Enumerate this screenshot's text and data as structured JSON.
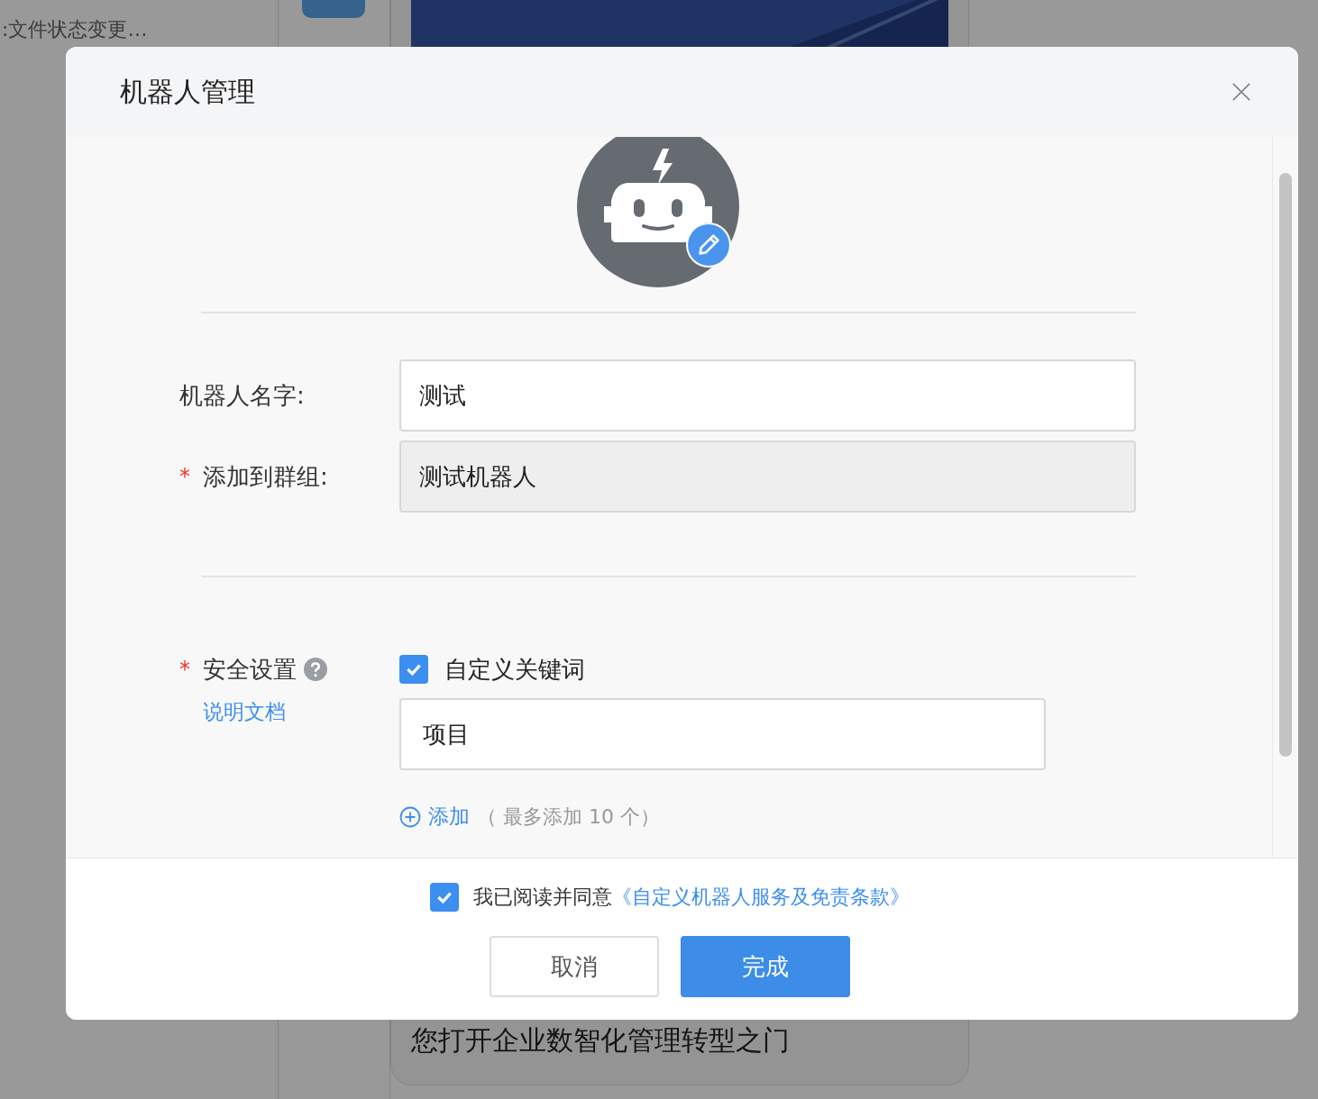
{
  "background": {
    "list_item_subtitle": ":文件状态变更…",
    "card_text": "您打开企业数智化管理转型之门"
  },
  "dialog": {
    "title": "机器人管理",
    "fields": [
      {
        "label": "机器人名字:",
        "value": "测试",
        "disabled": false
      },
      {
        "label": "添加到群组:",
        "required_mark": "*",
        "value": "测试机器人",
        "disabled": true
      }
    ],
    "security": {
      "label": "安全设置",
      "required_mark": "*",
      "help_link": "说明文档",
      "option": {
        "label": "自定义关键词",
        "checked": true
      },
      "keywords": [
        "项目"
      ],
      "add_link": "添加",
      "add_hint": "（ 最多添加 10 个）"
    },
    "agreement": {
      "text": "我已阅读并同意",
      "link": "《自定义机器人服务及免责条款》",
      "checked": true
    },
    "buttons": [
      {
        "label": "取消",
        "kind": "secondary"
      },
      {
        "label": "完成",
        "kind": "primary"
      }
    ]
  }
}
